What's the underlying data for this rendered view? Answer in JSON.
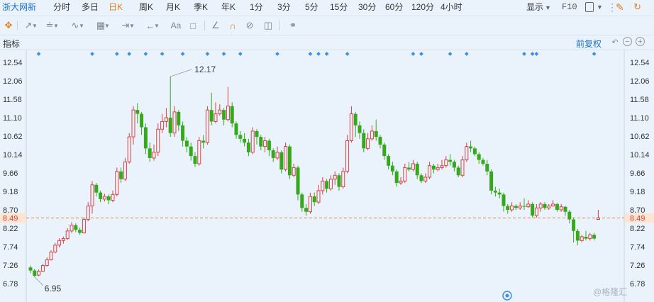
{
  "tabs": [
    {
      "label": "浙大网新",
      "type": "stock"
    },
    {
      "label": "分时"
    },
    {
      "label": "多日"
    },
    {
      "label": "日K",
      "active": true
    },
    {
      "label": "周K"
    },
    {
      "label": "月K"
    },
    {
      "label": "季K"
    },
    {
      "label": "年K"
    },
    {
      "label": "1分"
    },
    {
      "label": "3分"
    },
    {
      "label": "5分"
    },
    {
      "label": "15分"
    },
    {
      "label": "30分"
    },
    {
      "label": "60分"
    },
    {
      "label": "120分"
    },
    {
      "label": "4小时"
    }
  ],
  "topright": {
    "display_label": "显示",
    "f10_label": "F10"
  },
  "panel": {
    "indicator_label": "指标",
    "adjust_label": "前复权"
  },
  "watermark": "@格隆汇",
  "colors": {
    "up": "#d94040",
    "down": "#35a81c",
    "price_line": "#e87b2a",
    "axis_text": "#333333",
    "marker": "#3a8ee6",
    "accent": "#e57f1b"
  },
  "chart_data": {
    "type": "candlestick",
    "y_ticks": [
      12.54,
      12.06,
      11.58,
      11.1,
      10.62,
      10.14,
      9.66,
      9.18,
      8.7,
      8.22,
      7.74,
      7.26,
      6.78
    ],
    "current_price": 8.49,
    "annotations": [
      {
        "text": "12.17",
        "kind": "high"
      },
      {
        "text": "6.95",
        "kind": "low"
      }
    ],
    "ylim": [
      6.72,
      12.58
    ],
    "candles": [
      [
        7.2,
        7.12,
        7.25,
        7.05
      ],
      [
        7.12,
        6.98,
        7.16,
        6.95
      ],
      [
        7.0,
        7.1,
        7.15,
        6.97
      ],
      [
        7.1,
        7.25,
        7.3,
        7.08
      ],
      [
        7.25,
        7.4,
        7.46,
        7.22
      ],
      [
        7.4,
        7.6,
        7.65,
        7.38
      ],
      [
        7.6,
        7.78,
        7.84,
        7.57
      ],
      [
        7.78,
        7.9,
        7.96,
        7.72
      ],
      [
        7.9,
        7.95,
        8.0,
        7.82
      ],
      [
        7.95,
        8.15,
        8.22,
        7.92
      ],
      [
        8.15,
        8.3,
        8.38,
        8.1
      ],
      [
        8.3,
        8.18,
        8.35,
        8.12
      ],
      [
        8.18,
        8.1,
        8.24,
        8.05
      ],
      [
        8.1,
        8.45,
        8.5,
        8.08
      ],
      [
        8.45,
        8.8,
        8.9,
        8.4
      ],
      [
        8.8,
        9.35,
        9.45,
        8.6
      ],
      [
        9.35,
        9.15,
        9.4,
        9.05
      ],
      [
        9.15,
        8.98,
        9.2,
        8.9
      ],
      [
        8.98,
        9.05,
        9.12,
        8.92
      ],
      [
        9.05,
        8.95,
        9.1,
        8.85
      ],
      [
        8.95,
        9.1,
        9.2,
        8.9
      ],
      [
        9.1,
        9.7,
        9.8,
        9.05
      ],
      [
        9.7,
        9.5,
        9.8,
        9.4
      ],
      [
        9.5,
        9.95,
        10.05,
        9.45
      ],
      [
        9.95,
        10.6,
        10.7,
        9.9
      ],
      [
        10.6,
        11.3,
        11.4,
        10.4
      ],
      [
        11.3,
        11.2,
        11.48,
        10.95
      ],
      [
        11.2,
        10.85,
        11.25,
        10.65
      ],
      [
        10.85,
        10.3,
        10.95,
        10.15
      ],
      [
        10.3,
        10.05,
        10.45,
        9.95
      ],
      [
        10.05,
        10.2,
        10.4,
        9.98
      ],
      [
        10.2,
        10.8,
        10.95,
        10.1
      ],
      [
        10.8,
        11.0,
        11.2,
        10.7
      ],
      [
        11.0,
        11.1,
        11.35,
        10.85
      ],
      [
        11.1,
        10.7,
        12.17,
        10.6
      ],
      [
        10.7,
        11.25,
        11.4,
        10.6
      ],
      [
        11.25,
        10.9,
        11.3,
        10.75
      ],
      [
        10.9,
        10.5,
        11.0,
        10.35
      ],
      [
        10.5,
        10.35,
        10.6,
        10.2
      ],
      [
        10.35,
        10.1,
        10.45,
        9.98
      ],
      [
        10.1,
        9.9,
        10.2,
        9.82
      ],
      [
        9.9,
        10.5,
        10.6,
        9.85
      ],
      [
        10.5,
        10.45,
        10.65,
        10.3
      ],
      [
        10.45,
        11.3,
        11.4,
        10.4
      ],
      [
        11.3,
        11.0,
        11.75,
        10.9
      ],
      [
        11.0,
        11.2,
        11.5,
        10.95
      ],
      [
        11.2,
        11.3,
        11.45,
        11.15
      ],
      [
        11.3,
        11.05,
        11.35,
        10.9
      ],
      [
        11.05,
        11.4,
        11.9,
        11.0
      ],
      [
        11.4,
        10.95,
        11.5,
        10.85
      ],
      [
        10.95,
        10.65,
        11.0,
        10.55
      ],
      [
        10.65,
        10.55,
        10.75,
        10.45
      ],
      [
        10.55,
        10.45,
        10.7,
        10.35
      ],
      [
        10.45,
        10.2,
        10.55,
        10.1
      ],
      [
        10.2,
        10.75,
        10.85,
        10.15
      ],
      [
        10.75,
        10.6,
        10.8,
        10.4
      ],
      [
        10.6,
        10.35,
        10.65,
        10.25
      ],
      [
        10.35,
        10.5,
        10.6,
        10.2
      ],
      [
        10.5,
        10.25,
        10.55,
        10.1
      ],
      [
        10.25,
        10.05,
        10.3,
        9.95
      ],
      [
        10.05,
        10.2,
        10.35,
        10.0
      ],
      [
        10.2,
        9.75,
        10.25,
        9.65
      ],
      [
        9.75,
        10.35,
        10.45,
        9.7
      ],
      [
        10.35,
        9.6,
        10.4,
        9.5
      ],
      [
        9.6,
        9.8,
        9.9,
        9.55
      ],
      [
        9.8,
        9.1,
        9.85,
        8.95
      ],
      [
        9.1,
        8.75,
        9.15,
        8.65
      ],
      [
        8.75,
        8.65,
        8.85,
        8.55
      ],
      [
        8.65,
        9.05,
        9.15,
        8.6
      ],
      [
        9.05,
        8.9,
        9.15,
        8.8
      ],
      [
        8.9,
        9.2,
        9.35,
        8.85
      ],
      [
        9.2,
        9.45,
        9.55,
        9.1
      ],
      [
        9.45,
        9.25,
        9.5,
        9.15
      ],
      [
        9.25,
        9.5,
        9.6,
        9.2
      ],
      [
        9.5,
        9.6,
        9.7,
        9.35
      ],
      [
        9.6,
        9.3,
        9.65,
        9.2
      ],
      [
        9.3,
        9.7,
        9.8,
        9.25
      ],
      [
        9.7,
        10.5,
        10.65,
        9.65
      ],
      [
        10.5,
        11.2,
        11.4,
        10.45
      ],
      [
        11.2,
        10.9,
        11.25,
        10.6
      ],
      [
        10.9,
        10.7,
        11.0,
        10.55
      ],
      [
        10.7,
        10.3,
        10.8,
        10.2
      ],
      [
        10.3,
        10.55,
        10.7,
        10.25
      ],
      [
        10.55,
        10.75,
        10.9,
        10.5
      ],
      [
        10.75,
        10.6,
        11.05,
        10.5
      ],
      [
        10.6,
        10.4,
        10.65,
        10.3
      ],
      [
        10.4,
        10.1,
        10.45,
        10.0
      ],
      [
        10.1,
        9.85,
        10.15,
        9.75
      ],
      [
        9.85,
        9.7,
        9.95,
        9.6
      ],
      [
        9.7,
        9.4,
        9.75,
        9.3
      ],
      [
        9.4,
        9.45,
        9.55,
        9.35
      ],
      [
        9.45,
        9.8,
        9.9,
        9.4
      ],
      [
        9.8,
        9.75,
        9.95,
        9.7
      ],
      [
        9.75,
        9.9,
        10.0,
        9.7
      ],
      [
        9.9,
        9.6,
        9.95,
        9.5
      ],
      [
        9.6,
        9.45,
        9.65,
        9.4
      ],
      [
        9.45,
        9.55,
        9.65,
        9.4
      ],
      [
        9.55,
        9.85,
        9.95,
        9.5
      ],
      [
        9.85,
        9.75,
        9.9,
        9.65
      ],
      [
        9.75,
        9.8,
        9.9,
        9.7
      ],
      [
        9.8,
        9.85,
        10.0,
        9.75
      ],
      [
        9.85,
        10.0,
        10.1,
        9.8
      ],
      [
        10.0,
        9.95,
        10.15,
        9.85
      ],
      [
        9.95,
        9.8,
        10.0,
        9.7
      ],
      [
        9.8,
        9.6,
        9.85,
        9.55
      ],
      [
        9.6,
        10.0,
        10.1,
        9.55
      ],
      [
        10.0,
        10.35,
        10.45,
        9.95
      ],
      [
        10.35,
        10.3,
        10.5,
        10.2
      ],
      [
        10.3,
        10.15,
        10.35,
        10.1
      ],
      [
        10.15,
        10.0,
        10.2,
        9.9
      ],
      [
        10.0,
        9.9,
        10.05,
        9.85
      ],
      [
        9.9,
        9.7,
        10.0,
        9.6
      ],
      [
        9.7,
        9.2,
        9.75,
        9.1
      ],
      [
        9.2,
        9.15,
        9.3,
        9.05
      ],
      [
        9.15,
        9.1,
        9.25,
        9.0
      ],
      [
        9.1,
        8.8,
        9.15,
        8.65
      ],
      [
        8.8,
        8.7,
        8.85,
        8.6
      ],
      [
        8.7,
        8.8,
        8.9,
        8.65
      ],
      [
        8.8,
        8.75,
        8.85,
        8.7
      ],
      [
        8.75,
        8.8,
        8.9,
        8.7
      ],
      [
        8.8,
        8.78,
        9.0,
        8.7
      ],
      [
        8.78,
        8.85,
        8.95,
        8.75
      ],
      [
        8.85,
        8.55,
        8.9,
        8.5
      ],
      [
        8.55,
        8.75,
        8.85,
        8.5
      ],
      [
        8.75,
        8.85,
        8.9,
        8.65
      ],
      [
        8.85,
        8.75,
        8.9,
        8.7
      ],
      [
        8.75,
        8.8,
        8.85,
        8.7
      ],
      [
        8.8,
        8.85,
        8.95,
        8.78
      ],
      [
        8.85,
        8.7,
        8.88,
        8.65
      ],
      [
        8.7,
        8.78,
        8.85,
        8.65
      ],
      [
        8.78,
        8.65,
        8.8,
        8.55
      ],
      [
        8.65,
        8.45,
        8.7,
        8.35
      ],
      [
        8.45,
        8.15,
        8.5,
        7.85
      ],
      [
        8.15,
        7.9,
        8.2,
        7.78
      ],
      [
        7.9,
        8.0,
        8.05,
        7.85
      ],
      [
        8.0,
        7.95,
        8.15,
        7.9
      ],
      [
        7.95,
        8.05,
        8.1,
        7.9
      ],
      [
        8.05,
        7.95,
        8.1,
        7.9
      ],
      [
        8.45,
        8.49,
        8.7,
        8.45
      ]
    ],
    "gaps_after": [
      139
    ],
    "markers": [
      2,
      15,
      21,
      24,
      28,
      32,
      37,
      43,
      47,
      51,
      60,
      68,
      70,
      72,
      77,
      93,
      95,
      102,
      106,
      120,
      122,
      123,
      137
    ]
  }
}
